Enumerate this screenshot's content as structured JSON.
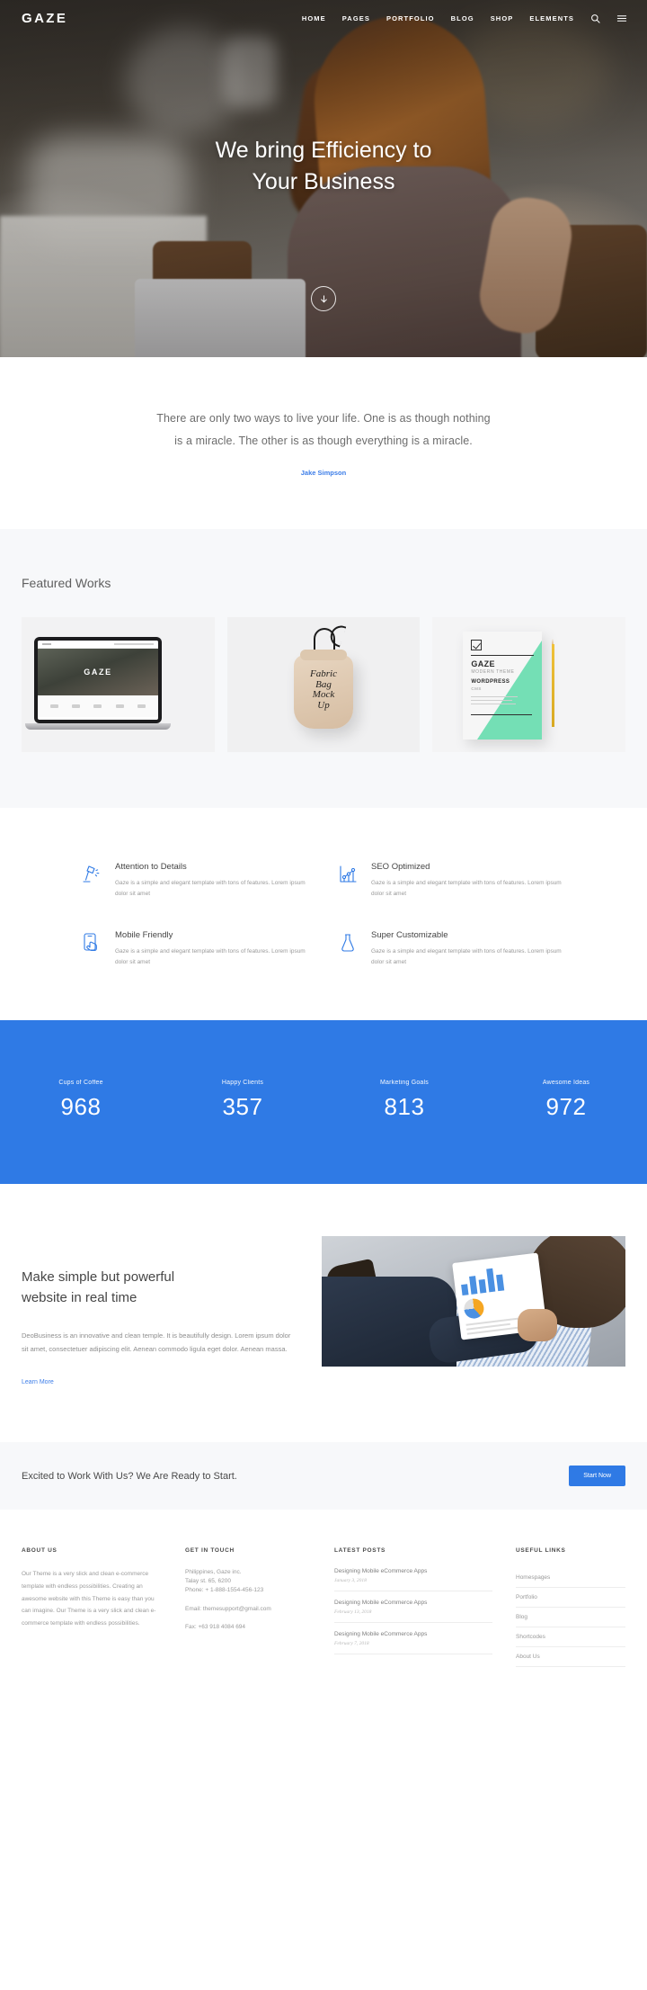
{
  "brand": "GAZE",
  "nav": {
    "items": [
      "HOME",
      "PAGES",
      "PORTFOLIO",
      "BLOG",
      "SHOP",
      "ELEMENTS"
    ],
    "search_icon": "search-icon",
    "menu_icon": "hamburger-menu-icon"
  },
  "hero": {
    "title_line1": "We bring Efficiency to",
    "title_line2": "Your Business",
    "scroll_icon": "arrow-down-circle-icon"
  },
  "quote": {
    "line1": "There are only two ways to live your life. One is as though nothing",
    "line2": "is a miracle. The other is as though everything is a miracle.",
    "author": "Jake Simpson",
    "author_color": "#3c7de8"
  },
  "works": {
    "heading": "Featured Works",
    "items": [
      {
        "name": "macbook-mockup",
        "label": "GAZE"
      },
      {
        "name": "fabric-bag-mockup",
        "label": "Fabric Bag Mockup"
      },
      {
        "name": "flyer-mockup",
        "label": "GAZE"
      }
    ],
    "flyer": {
      "title": "GAZE",
      "subtitle": "MODERN THEME",
      "line3": "WORDPRESS",
      "line4": "CMS"
    }
  },
  "features": [
    {
      "icon": "desk-lamp-icon",
      "title": "Attention to Details",
      "desc": "Gaze is a simple and elegant template with tons of features. Lorem ipsum dolor sit amet"
    },
    {
      "icon": "chart-graph-icon",
      "title": "SEO Optimized",
      "desc": "Gaze is a simple and elegant template with tons of features. Lorem ipsum dolor sit amet"
    },
    {
      "icon": "mobile-hand-icon",
      "title": "Mobile Friendly",
      "desc": "Gaze is a simple and elegant template with tons of features. Lorem ipsum dolor sit amet"
    },
    {
      "icon": "flask-icon",
      "title": "Super Customizable",
      "desc": "Gaze is a simple and elegant template with tons of features. Lorem ipsum dolor sit amet"
    }
  ],
  "stats": {
    "background_color": "#2f7ae5",
    "items": [
      {
        "label": "Cups of Coffee",
        "value": "968"
      },
      {
        "label": "Happy Clients",
        "value": "357"
      },
      {
        "label": "Marketing Goals",
        "value": "813"
      },
      {
        "label": "Awesome Ideas",
        "value": "972"
      }
    ]
  },
  "promo": {
    "title_line1": "Make simple but powerful",
    "title_line2": "website in real time",
    "text": "DeoBusiness is an innovative and clean temple. It is beautifully design. Lorem ipsum dolor sit amet, consectetuer adipiscing elit. Aenean commodo ligula eget dolor. Aenean massa.",
    "link": "Learn More",
    "image_name": "man-holding-tablet-photo"
  },
  "cta": {
    "text": "Excited to Work With Us? We Are Ready to Start.",
    "button": "Start Now",
    "button_color": "#2f7ae5"
  },
  "footer": {
    "about": {
      "heading": "ABOUT US",
      "text": "Our Theme is a very slick and clean e-commerce template with endless possibilities. Creating an awesome website with this Theme is easy than you can imagine. Our Theme is a very slick and clean e-commerce template with endless possibilities."
    },
    "touch": {
      "heading": "GET IN TOUCH",
      "address1": "Philippines, Gaze inc.",
      "address2": "Talay st. 65, 6200",
      "phone": "Phone: + 1-888-1554-456-123",
      "email": "Email: themesupport@gmail.com",
      "fax": "Fax: +63 918 4084 694"
    },
    "posts": {
      "heading": "LATEST POSTS",
      "items": [
        {
          "title": "Designing Mobile eCommerce Apps",
          "date": "January 3, 2018"
        },
        {
          "title": "Designing Mobile eCommerce Apps",
          "date": "February 13, 2018"
        },
        {
          "title": "Designing Mobile eCommerce Apps",
          "date": "February 7, 2018"
        }
      ]
    },
    "links": {
      "heading": "USEFUL LINKS",
      "items": [
        "Homespages",
        "Portfolio",
        "Blog",
        "Shortcodes",
        "About Us"
      ]
    }
  }
}
